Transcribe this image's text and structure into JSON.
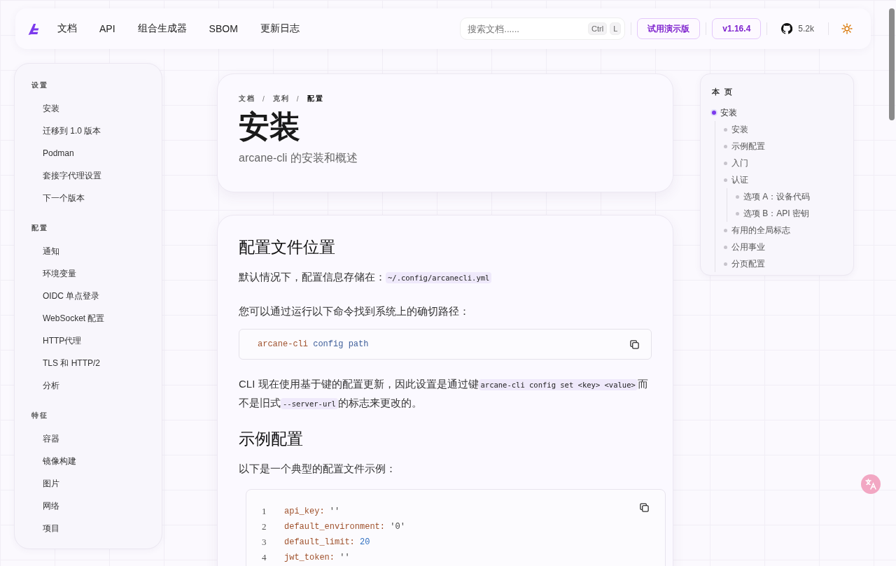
{
  "header": {
    "nav": [
      {
        "label": "文档"
      },
      {
        "label": "API"
      },
      {
        "label": "组合生成器"
      },
      {
        "label": "SBOM"
      },
      {
        "label": "更新日志"
      }
    ],
    "search": {
      "placeholder": "搜索文档......",
      "keys": [
        "Ctrl",
        "L"
      ]
    },
    "demo_button": "试用演示版",
    "version": "v1.16.4",
    "stars": "5.2k"
  },
  "sidebar": {
    "sections": [
      {
        "title": "设置",
        "items": [
          "安装",
          "迁移到 1.0 版本",
          "Podman",
          "套接字代理设置",
          "下一个版本"
        ]
      },
      {
        "title": "配置",
        "items": [
          "通知",
          "环境变量",
          "OIDC 单点登录",
          "WebSocket 配置",
          "HTTP代理",
          "TLS 和 HTTP/2",
          "分析"
        ]
      },
      {
        "title": "特征",
        "items": [
          "容器",
          "镜像构建",
          "图片",
          "网络",
          "项目"
        ]
      }
    ]
  },
  "hero": {
    "breadcrumb": [
      "文档",
      "克利",
      "配置"
    ],
    "breadcrumb_separator": "/",
    "title": "安装",
    "subtitle": "arcane-cli 的安装和概述"
  },
  "content": [
    {
      "kind": "heading",
      "text": "配置文件位置"
    },
    {
      "kind": "paragraph",
      "parts": [
        {
          "text": "默认情况下，配置信息存储在：",
          "kind": "text"
        },
        {
          "text": "~/.config/arcanecli.yml",
          "kind": "code"
        }
      ]
    },
    {
      "kind": "paragraph",
      "parts": [
        {
          "text": "您可以通过运行以下命令找到系统上的确切路径：",
          "kind": "text"
        }
      ]
    },
    {
      "kind": "command",
      "tokens": [
        {
          "text": "arcane-cli",
          "kind": "program"
        },
        {
          "text": "config path",
          "kind": "argument"
        }
      ]
    },
    {
      "kind": "paragraph",
      "parts": [
        {
          "text": "CLI 现在使用基于键的配置更新，因此设置是通过键",
          "kind": "text"
        },
        {
          "text": "arcane-cli config set <key> <value>",
          "kind": "code"
        },
        {
          "text": "而不是旧式",
          "kind": "text"
        },
        {
          "text": "--server-url",
          "kind": "code"
        },
        {
          "text": "的标志来更改的。",
          "kind": "text"
        }
      ]
    },
    {
      "kind": "heading",
      "text": "示例配置"
    },
    {
      "kind": "paragraph",
      "parts": [
        {
          "text": "以下是一个典型的配置文件示例：",
          "kind": "text"
        }
      ]
    },
    {
      "kind": "codeblock",
      "lines": [
        {
          "number": "1",
          "key": "api_key:",
          "value": "''",
          "kind": "string"
        },
        {
          "number": "2",
          "key": "default_environment:",
          "value": "'0'",
          "kind": "string"
        },
        {
          "number": "3",
          "key": "default_limit:",
          "value": "20",
          "kind": "number"
        },
        {
          "number": "4",
          "key": "jwt_token:",
          "value": "''",
          "kind": "string"
        }
      ]
    }
  ],
  "toc": {
    "title": "本 页",
    "items": [
      {
        "label": "安装",
        "selected": true,
        "children": [
          {
            "label": "安装",
            "selected": false
          },
          {
            "label": "示例配置",
            "selected": false
          },
          {
            "label": "入门",
            "selected": false
          },
          {
            "label": "认证",
            "selected": false,
            "children": [
              {
                "label": "选项 A：设备代码",
                "selected": false
              },
              {
                "label": "选项 B：API 密钥",
                "selected": false
              }
            ]
          },
          {
            "label": "有用的全局标志",
            "selected": false
          },
          {
            "label": "公用事业",
            "selected": false
          },
          {
            "label": "分页配置",
            "selected": false
          }
        ]
      }
    ]
  }
}
